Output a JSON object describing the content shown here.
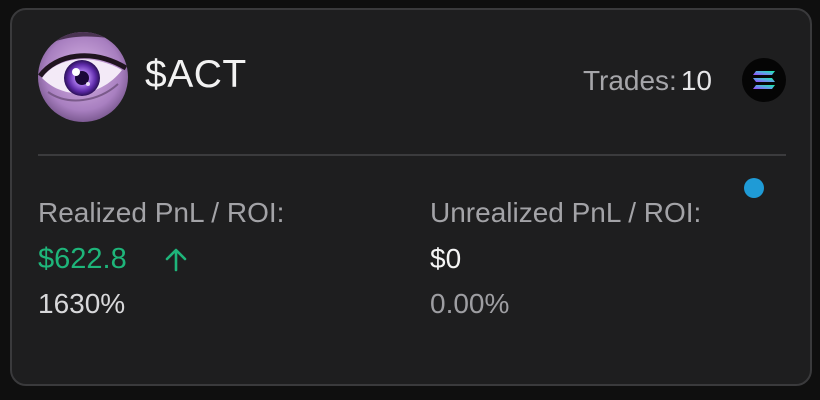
{
  "token": {
    "symbol": "$ACT",
    "avatar_icon": "anime-eye-avatar",
    "trades_label": "Trades:",
    "trades_count": "10",
    "chain_icon": "solana-icon"
  },
  "realized": {
    "label": "Realized PnL / ROI:",
    "value": "$622.8",
    "roi": "1630%",
    "trend_icon": "arrow-up-icon",
    "color": "#1eb57a"
  },
  "unrealized": {
    "label": "Unrealized PnL / ROI:",
    "value": "$0",
    "roi": "0.00%"
  },
  "status_indicator": {
    "color": "#1f9bd6"
  }
}
